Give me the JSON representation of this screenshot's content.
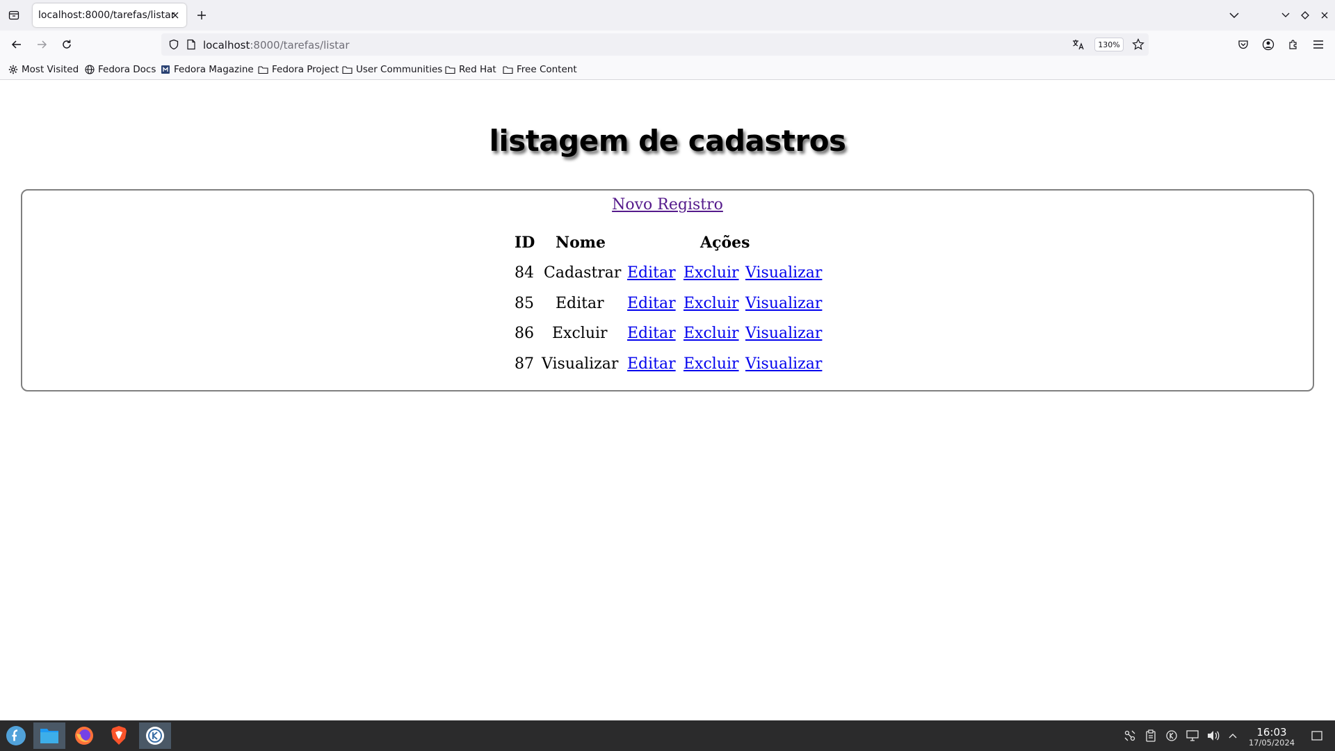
{
  "browser": {
    "tab_title": "localhost:8000/tarefas/listar",
    "url_host": "localhost",
    "url_rest": ":8000/tarefas/listar",
    "zoom": "130%",
    "bookmarks": [
      {
        "label": "Most Visited",
        "icon": "gear-icon"
      },
      {
        "label": "Fedora Docs",
        "icon": "globe-icon"
      },
      {
        "label": "Fedora Magazine",
        "icon": "fedora-magazine-icon"
      },
      {
        "label": "Fedora Project",
        "icon": "folder-icon"
      },
      {
        "label": "User Communities",
        "icon": "folder-icon"
      },
      {
        "label": "Red Hat",
        "icon": "folder-icon"
      },
      {
        "label": "Free Content",
        "icon": "folder-icon"
      }
    ]
  },
  "page": {
    "title": "listagem de cadastros",
    "new_record_link": "Novo Registro",
    "table": {
      "headers": {
        "id": "ID",
        "nome": "Nome",
        "acoes": "Ações"
      },
      "rows": [
        {
          "id": "84",
          "nome": "Cadastrar",
          "actions": [
            "Editar",
            "Excluir",
            "Visualizar"
          ]
        },
        {
          "id": "85",
          "nome": "Editar",
          "actions": [
            "Editar",
            "Excluir",
            "Visualizar"
          ]
        },
        {
          "id": "86",
          "nome": "Excluir",
          "actions": [
            "Editar",
            "Excluir",
            "Visualizar"
          ]
        },
        {
          "id": "87",
          "nome": "Visualizar",
          "actions": [
            "Editar",
            "Excluir",
            "Visualizar"
          ]
        }
      ]
    }
  },
  "taskbar": {
    "apps": [
      "fedora-start-icon",
      "file-manager-icon",
      "firefox-icon",
      "brave-icon",
      "kde-connect-icon"
    ],
    "time": "16:03",
    "date": "17/05/2024"
  }
}
